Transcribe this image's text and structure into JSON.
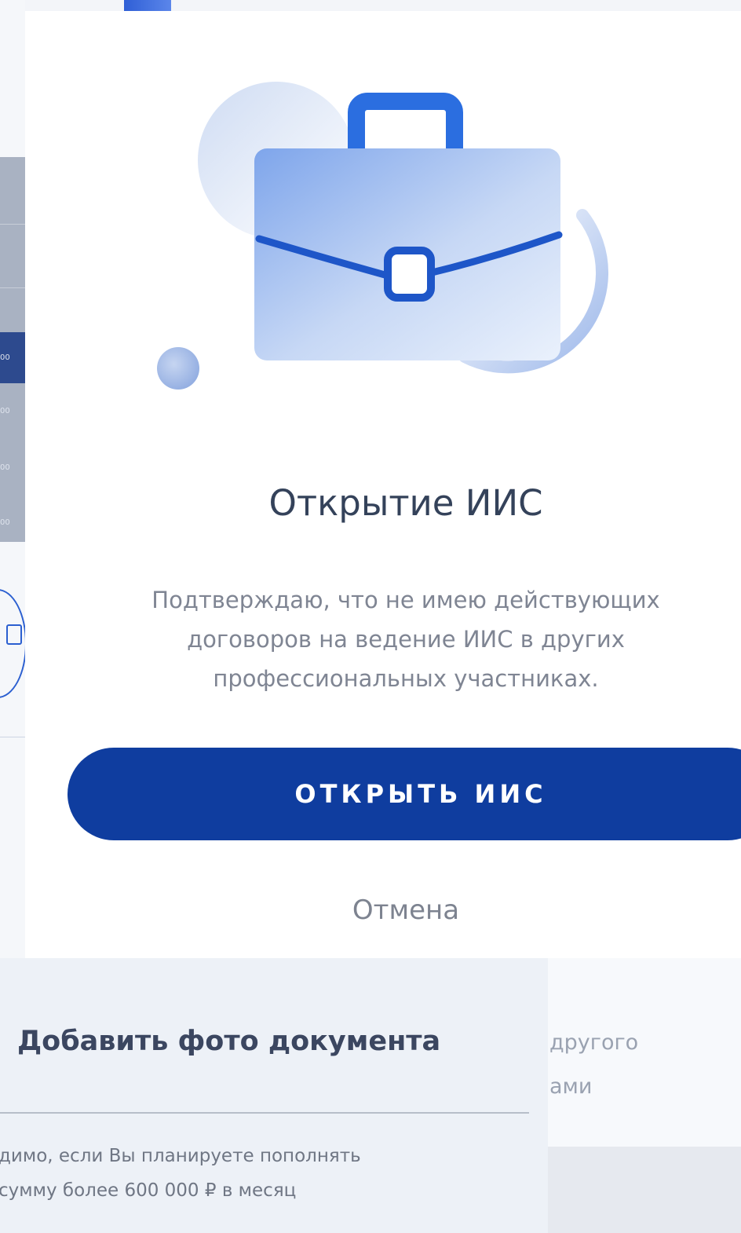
{
  "dialog": {
    "title": "Открытие ИИС",
    "text": "Подтверждаю, что не имею действующих договоров на ведение ИИС в других профессиональных участниках.",
    "primary_button": "ОТКРЫТЬ ИИС",
    "cancel": "Отмена",
    "illustration_icon": "briefcase-icon",
    "colors": {
      "primary": "#0f3d9f",
      "title": "#34425a"
    }
  },
  "sheet": {
    "title": "Добавить фото документа",
    "text_line1": "димо, если Вы планируете пополнять",
    "text_line2": "сумму более 600 000 ₽ в месяц"
  },
  "background": {
    "right_text_line1": "другого",
    "right_text_line2": "ами",
    "left_ticks": [
      "00",
      "00",
      "00",
      "00"
    ]
  }
}
